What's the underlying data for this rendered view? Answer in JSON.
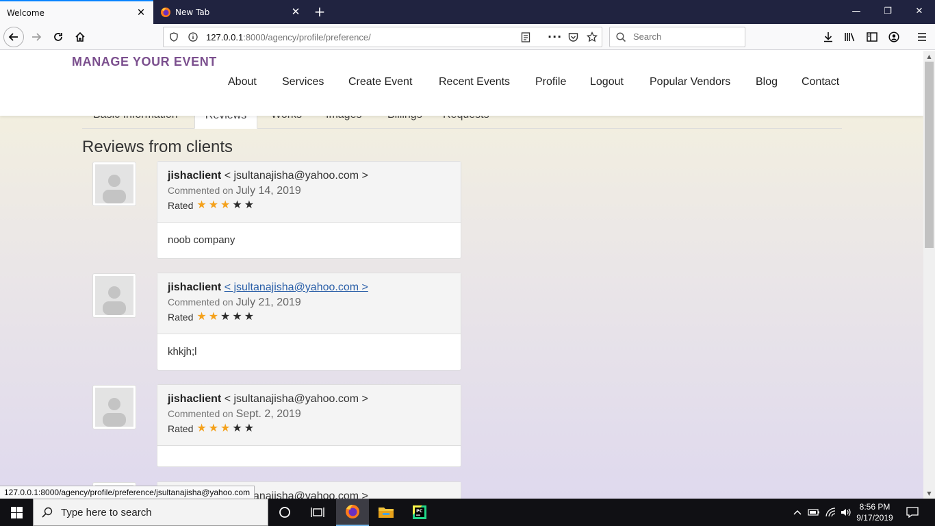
{
  "browser": {
    "tabs": [
      {
        "title": "Welcome",
        "active": true
      },
      {
        "title": "New Tab",
        "active": false
      }
    ],
    "url": {
      "host": "127.0.0.1",
      "rest": ":8000/agency/profile/preference/"
    },
    "search_placeholder": "Search",
    "status_url": "127.0.0.1:8000/agency/profile/preference/jsultanajisha@yahoo.com"
  },
  "site": {
    "brand": "MANAGE YOUR EVENT",
    "menu": [
      "About",
      "Services",
      "Create Event",
      "Recent Events",
      "Profile",
      "Logout",
      "Popular Vendors",
      "Blog",
      "Contact"
    ]
  },
  "profile_tabs": [
    "Basic Information",
    "Reviews",
    "Works",
    "Images",
    "Billings",
    "Requests"
  ],
  "active_tab": "Reviews",
  "section_title": "Reviews from clients",
  "reviews": [
    {
      "name": "jishaclient",
      "email": "< jsultanajisha@yahoo.com >",
      "commented_label": "Commented on",
      "date": "July 14, 2019",
      "rated_label": "Rated",
      "rating": 3,
      "max_rating": 5,
      "comment": "noob company",
      "email_hovered": false
    },
    {
      "name": "jishaclient",
      "email": "< jsultanajisha@yahoo.com >",
      "commented_label": "Commented on",
      "date": "July 21, 2019",
      "rated_label": "Rated",
      "rating": 2,
      "max_rating": 5,
      "comment": "khkjh;l",
      "email_hovered": true
    },
    {
      "name": "jishaclient",
      "email": "< jsultanajisha@yahoo.com >",
      "commented_label": "Commented on",
      "date": "Sept. 2, 2019",
      "rated_label": "Rated",
      "rating": 3,
      "max_rating": 5,
      "comment": "",
      "email_hovered": false
    },
    {
      "name": "jishaclient",
      "email": "< jsultanajisha@yahoo.com >",
      "commented_label": "",
      "date": "",
      "rated_label": "",
      "rating": 0,
      "max_rating": 5,
      "comment": "",
      "email_hovered": false
    }
  ],
  "taskbar": {
    "search_text": "Type here to search",
    "time": "8:56 PM",
    "date": "9/17/2019",
    "apps": [
      "cortana-icon",
      "task-view-icon",
      "firefox-icon",
      "file-explorer-icon",
      "pycharm-icon"
    ]
  },
  "colors": {
    "brand": "#7b4f8e",
    "star_on": "#f4a11b",
    "star_off": "#2b2b2b",
    "link": "#2a5fa8",
    "tab_accent": "#0a84ff"
  }
}
